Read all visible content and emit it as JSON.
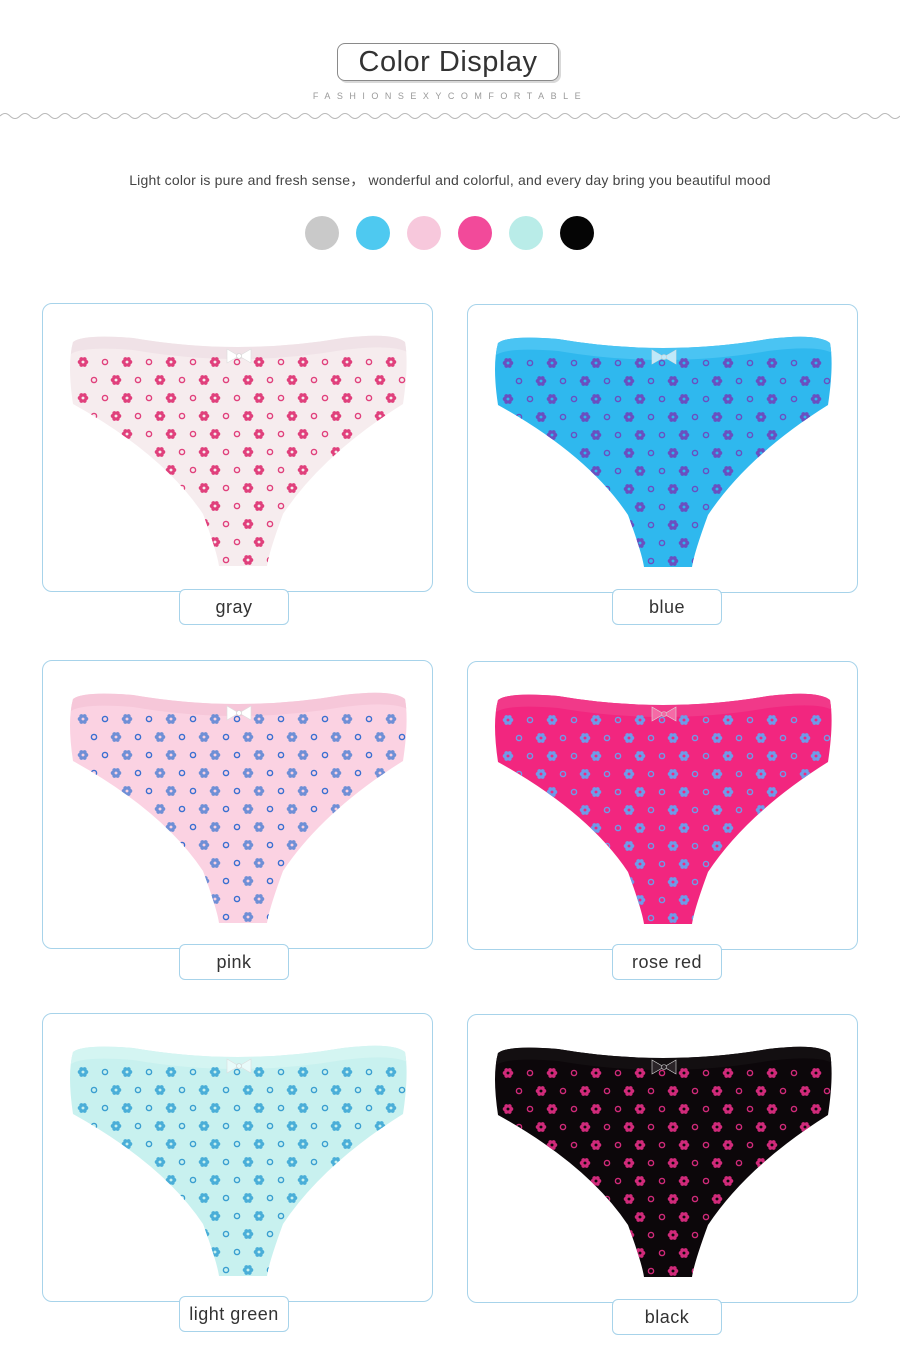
{
  "header": {
    "title": "Color Display",
    "tagline": "FASHIONSEXYCOMFORTABLE"
  },
  "description": "Light color is pure and fresh sense，  wonderful and colorful, and every day bring you beautiful mood",
  "swatches": [
    {
      "name": "gray",
      "color": "#c9c9c9"
    },
    {
      "name": "blue",
      "color": "#4ec9f0"
    },
    {
      "name": "pink",
      "color": "#f7c8dc"
    },
    {
      "name": "rose red",
      "color": "#f24a9a"
    },
    {
      "name": "light green",
      "color": "#b9ece8"
    },
    {
      "name": "black",
      "color": "#050505"
    }
  ],
  "products": [
    {
      "label": "gray",
      "fabric": "#f6ecee",
      "lace": "#efe2e6",
      "flower": "#e0407c",
      "dot": "#e0407c",
      "bow": "#ffffff"
    },
    {
      "label": "blue",
      "fabric": "#2fb8ee",
      "lace": "#4cc4f2",
      "flower": "#6a4fc0",
      "dot": "#6a4fc0",
      "bow": "#bfe9fa"
    },
    {
      "label": "pink",
      "fabric": "#fbd2e2",
      "lace": "#f6c6d8",
      "flower": "#6f8fd6",
      "dot": "#3a6fd0",
      "bow": "#ffffff"
    },
    {
      "label": "rose red",
      "fabric": "#f2267f",
      "lace": "#f03a8a",
      "flower": "#6f9be8",
      "dot": "#6f9be8",
      "bow": "#f56aa6"
    },
    {
      "label": "light green",
      "fabric": "#c8f1ef",
      "lace": "#d5f4f1",
      "flower": "#4aaed8",
      "dot": "#3a9ed0",
      "bow": "#e8fbfa"
    },
    {
      "label": "black",
      "fabric": "#0c070a",
      "lace": "#141012",
      "flower": "#d02a7a",
      "dot": "#d02a7a",
      "bow": "#2a2428"
    }
  ]
}
